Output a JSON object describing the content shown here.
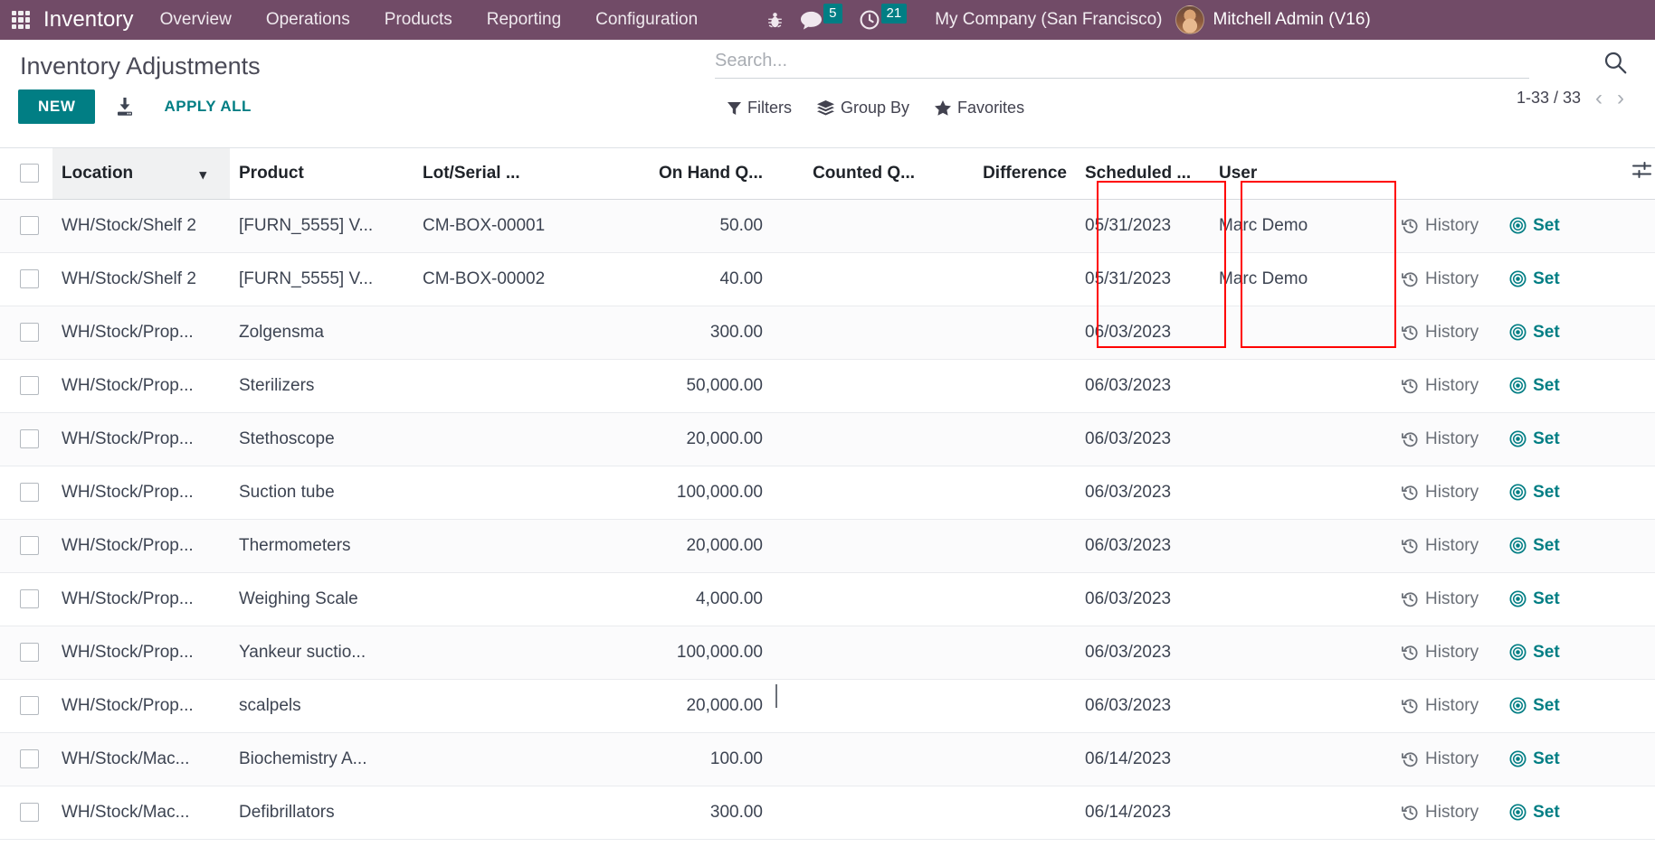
{
  "navbar": {
    "apps_icon": "apps-grid-icon",
    "brand": "Inventory",
    "menus": [
      "Overview",
      "Operations",
      "Products",
      "Reporting",
      "Configuration"
    ],
    "debug_icon": "bug-icon",
    "messages_icon": "speech-bubble-icon",
    "messages_count": "5",
    "activities_icon": "clock-icon",
    "activities_count": "21",
    "company": "My Company (San Francisco)",
    "avatar_icon": "user-avatar",
    "user": "Mitchell Admin (V16)",
    "bg_color": "#714B67"
  },
  "control_panel": {
    "title": "Inventory Adjustments",
    "new_label": "NEW",
    "import_icon": "import-download-icon",
    "apply_all_label": "APPLY ALL",
    "accent_color": "#017E84"
  },
  "search": {
    "placeholder": "Search...",
    "value": "",
    "search_icon": "search-icon",
    "filters_label": "Filters",
    "filters_icon": "filter-funnel-icon",
    "group_by_label": "Group By",
    "group_by_icon": "layers-icon",
    "favorites_label": "Favorites",
    "favorites_icon": "star-icon"
  },
  "pager": {
    "range": "1-33 / 33",
    "prev_icon": "chevron-left-icon",
    "next_icon": "chevron-right-icon"
  },
  "table": {
    "select_all_icon": "checkbox",
    "columns": [
      "Location",
      "Product",
      "Lot/Serial ...",
      "On Hand Q...",
      "Counted Q...",
      "Difference",
      "Scheduled ...",
      "User"
    ],
    "sort_column": "Location",
    "sort_caret_icon": "chevron-down-icon",
    "options_icon": "adjust-sliders-icon",
    "history_label": "History",
    "history_icon": "clock-rewind-icon",
    "set_label": "Set",
    "set_icon": "bullseye-icon",
    "rows": [
      {
        "location": "WH/Stock/Shelf 2",
        "product": "[FURN_5555] V...",
        "lot": "CM-BOX-00001",
        "on_hand": "50.00",
        "counted": "",
        "difference": "",
        "scheduled": "05/31/2023",
        "user": "Marc Demo"
      },
      {
        "location": "WH/Stock/Shelf 2",
        "product": "[FURN_5555] V...",
        "lot": "CM-BOX-00002",
        "on_hand": "40.00",
        "counted": "",
        "difference": "",
        "scheduled": "05/31/2023",
        "user": "Marc Demo"
      },
      {
        "location": "WH/Stock/Prop...",
        "product": "Zolgensma",
        "lot": "",
        "on_hand": "300.00",
        "counted": "",
        "difference": "",
        "scheduled": "06/03/2023",
        "user": ""
      },
      {
        "location": "WH/Stock/Prop...",
        "product": "Sterilizers",
        "lot": "",
        "on_hand": "50,000.00",
        "counted": "",
        "difference": "",
        "scheduled": "06/03/2023",
        "user": ""
      },
      {
        "location": "WH/Stock/Prop...",
        "product": "Stethoscope",
        "lot": "",
        "on_hand": "20,000.00",
        "counted": "",
        "difference": "",
        "scheduled": "06/03/2023",
        "user": ""
      },
      {
        "location": "WH/Stock/Prop...",
        "product": "Suction tube",
        "lot": "",
        "on_hand": "100,000.00",
        "counted": "",
        "difference": "",
        "scheduled": "06/03/2023",
        "user": ""
      },
      {
        "location": "WH/Stock/Prop...",
        "product": "Thermometers",
        "lot": "",
        "on_hand": "20,000.00",
        "counted": "",
        "difference": "",
        "scheduled": "06/03/2023",
        "user": ""
      },
      {
        "location": "WH/Stock/Prop...",
        "product": "Weighing Scale",
        "lot": "",
        "on_hand": "4,000.00",
        "counted": "",
        "difference": "",
        "scheduled": "06/03/2023",
        "user": ""
      },
      {
        "location": "WH/Stock/Prop...",
        "product": "Yankeur suctio...",
        "lot": "",
        "on_hand": "100,000.00",
        "counted": "",
        "difference": "",
        "scheduled": "06/03/2023",
        "user": ""
      },
      {
        "location": "WH/Stock/Prop...",
        "product": "scalpels",
        "lot": "",
        "on_hand": "20,000.00",
        "counted": "",
        "difference": "",
        "scheduled": "06/03/2023",
        "user": ""
      },
      {
        "location": "WH/Stock/Mac...",
        "product": "Biochemistry A...",
        "lot": "",
        "on_hand": "100.00",
        "counted": "",
        "difference": "",
        "scheduled": "06/14/2023",
        "user": ""
      },
      {
        "location": "WH/Stock/Mac...",
        "product": "Defibrillators",
        "lot": "",
        "on_hand": "300.00",
        "counted": "",
        "difference": "",
        "scheduled": "06/14/2023",
        "user": ""
      }
    ]
  },
  "annotations": [
    {
      "name": "scheduled-date-highlight",
      "color": "#ff0000"
    },
    {
      "name": "user-column-highlight",
      "color": "#ff0000"
    }
  ]
}
